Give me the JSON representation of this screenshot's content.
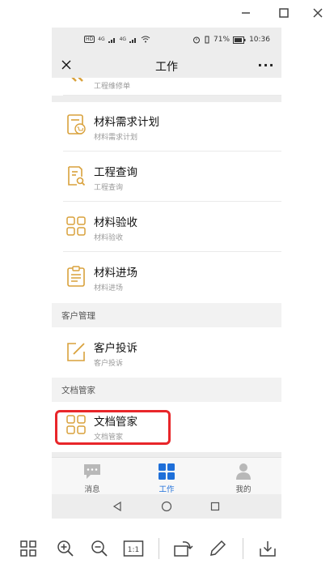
{
  "status_bar": {
    "left_tags": [
      "HD",
      "4G",
      "4G"
    ],
    "battery": "71%",
    "time": "10:36"
  },
  "app_bar": {
    "title": "工作",
    "more_label": "···"
  },
  "items_top": [
    {
      "title": "",
      "subtitle": "工程维修单",
      "icon": "wrench-icon"
    },
    {
      "title": "材料需求计划",
      "subtitle": "材料需求计划",
      "icon": "cart-document-icon"
    },
    {
      "title": "工程查询",
      "subtitle": "工程查询",
      "icon": "search-document-icon"
    },
    {
      "title": "材料验收",
      "subtitle": "材料验收",
      "icon": "grid-icon"
    },
    {
      "title": "材料进场",
      "subtitle": "材料进场",
      "icon": "clipboard-icon"
    }
  ],
  "sections": [
    {
      "label": "客户管理",
      "items": [
        {
          "title": "客户投诉",
          "subtitle": "客户投诉",
          "icon": "edit-icon"
        }
      ]
    },
    {
      "label": "文档管家",
      "items": [
        {
          "title": "文档管家",
          "subtitle": "文档管家",
          "icon": "grid-icon"
        }
      ]
    }
  ],
  "tabs": [
    {
      "label": "消息",
      "icon": "message-icon",
      "active": false
    },
    {
      "label": "工作",
      "icon": "apps-icon",
      "active": true
    },
    {
      "label": "我的",
      "icon": "user-icon",
      "active": false
    }
  ],
  "colors": {
    "accent_icon": "#d9a13b",
    "active_tab": "#1e6fd9",
    "highlight_border": "#e8262a"
  },
  "viewer_toolbar": [
    "grid-view-icon",
    "zoom-in-icon",
    "zoom-out-icon",
    "actual-size-icon",
    "rotate-icon",
    "edit-pen-icon",
    "download-icon"
  ],
  "actual_size_label": "1:1"
}
